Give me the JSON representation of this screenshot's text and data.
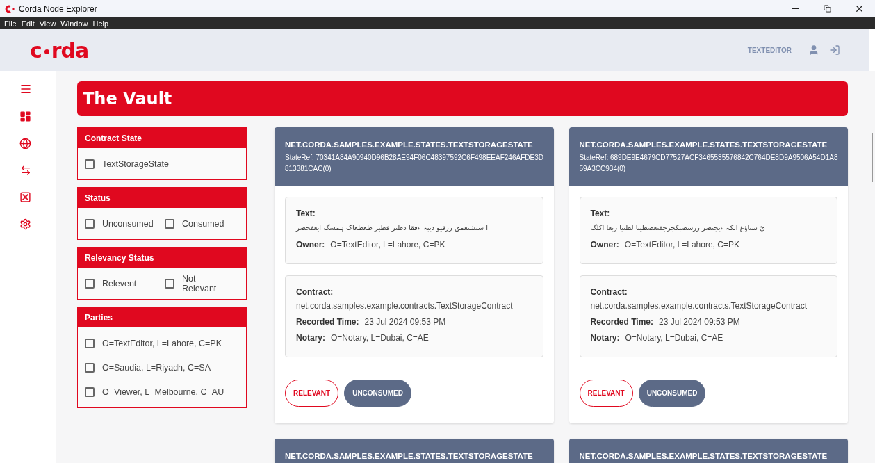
{
  "window": {
    "title": "Corda Node Explorer",
    "menu": [
      "File",
      "Edit",
      "View",
      "Window",
      "Help"
    ]
  },
  "header": {
    "logo_left": "c",
    "logo_right": "rda",
    "user": "TEXTEDITOR"
  },
  "page_title": "The Vault",
  "filters": [
    {
      "title": "Contract State",
      "options": [
        {
          "label": "TextStorageState",
          "checked": false
        }
      ]
    },
    {
      "title": "Status",
      "options": [
        {
          "label": "Unconsumed",
          "checked": false
        },
        {
          "label": "Consumed",
          "checked": false
        }
      ]
    },
    {
      "title": "Relevancy Status",
      "options": [
        {
          "label": "Relevent",
          "checked": false
        },
        {
          "label": "Not Relevant",
          "checked": false
        }
      ]
    },
    {
      "title": "Parties",
      "options": [
        {
          "label": "O=TextEditor, L=Lahore, C=PK",
          "checked": false
        },
        {
          "label": "O=Saudia, L=Riyadh, C=SA",
          "checked": false
        },
        {
          "label": "O=Viewer, L=Melbourne, C=AU",
          "checked": false
        }
      ]
    }
  ],
  "states": [
    {
      "title": "NET.CORDA.SAMPLES.EXAMPLE.STATES.TEXTSTORAGESTATE",
      "state_ref": "StateRef: 70341A84A90940D96B28AE94F06C48397592C6F498EEAF246AFDE3D813381CAC(0)",
      "groups": [
        [
          {
            "label": "Text:",
            "value": "ا سنشتعمق رزقیو دیبہ ءفقا دطنز فطیز طعطعاک ہمسگ ایعفحضر",
            "kind": "stacked"
          },
          {
            "label": "Owner:",
            "value": "O=TextEditor, L=Lahore, C=PK",
            "kind": "inline"
          }
        ],
        [
          {
            "label": "Contract:",
            "value": "net.corda.samples.example.contracts.TextStorageContract",
            "kind": "stacked"
          },
          {
            "label": "Recorded Time:",
            "value": "23 Jul 2024 09:53 PM",
            "kind": "inline"
          },
          {
            "label": "Notary:",
            "value": "O=Notary, L=Dubai, C=AE",
            "kind": "inline"
          }
        ]
      ],
      "chips": [
        {
          "label": "RELEVANT",
          "kind": "outline"
        },
        {
          "label": "UNCONSUMED",
          "kind": "filled"
        }
      ]
    },
    {
      "title": "NET.CORDA.SAMPLES.EXAMPLE.STATES.TEXTSTORAGESTATE",
      "state_ref": "StateRef: 689DE9E4679CD77527ACF3465535576842C764DE8D9A9506A54D1A859A3CC934(0)",
      "groups": [
        [
          {
            "label": "Text:",
            "value": "یٔ ستاؤغ اتکہ ءیجتصز زرسصبکجرجفتعضطینا لظنیا زبعا اکلگ",
            "kind": "stacked"
          },
          {
            "label": "Owner:",
            "value": "O=TextEditor, L=Lahore, C=PK",
            "kind": "inline"
          }
        ],
        [
          {
            "label": "Contract:",
            "value": "net.corda.samples.example.contracts.TextStorageContract",
            "kind": "stacked"
          },
          {
            "label": "Recorded Time:",
            "value": "23 Jul 2024 09:53 PM",
            "kind": "inline"
          },
          {
            "label": "Notary:",
            "value": "O=Notary, L=Dubai, C=AE",
            "kind": "inline"
          }
        ]
      ],
      "chips": [
        {
          "label": "RELEVANT",
          "kind": "outline"
        },
        {
          "label": "UNCONSUMED",
          "kind": "filled"
        }
      ]
    },
    {
      "title": "NET.CORDA.SAMPLES.EXAMPLE.STATES.TEXTSTORAGESTATE"
    },
    {
      "title": "NET.CORDA.SAMPLES.EXAMPLE.STATES.TEXTSTORAGESTATE"
    }
  ]
}
